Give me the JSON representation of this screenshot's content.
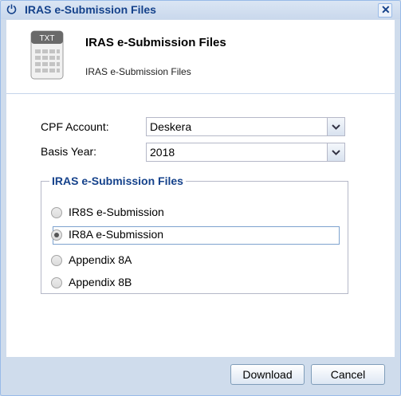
{
  "window": {
    "title": "IRAS e-Submission Files"
  },
  "header": {
    "icon_label": "TXT",
    "title": "IRAS e-Submission Files",
    "subtitle": "IRAS e-Submission Files"
  },
  "form": {
    "cpf_account": {
      "label": "CPF Account:",
      "value": "Deskera"
    },
    "basis_year": {
      "label": "Basis Year:",
      "value": "2018"
    },
    "fieldset": {
      "legend": "IRAS e-Submission Files",
      "options": [
        {
          "label": "IR8S e-Submission",
          "checked": false
        },
        {
          "label": "IR8A e-Submission",
          "checked": true
        },
        {
          "label": "Appendix 8A",
          "checked": false
        },
        {
          "label": "Appendix 8B",
          "checked": false
        }
      ]
    }
  },
  "buttons": {
    "download": "Download",
    "cancel": "Cancel"
  },
  "colors": {
    "title": "#15428b",
    "border": "#99bbe8"
  }
}
